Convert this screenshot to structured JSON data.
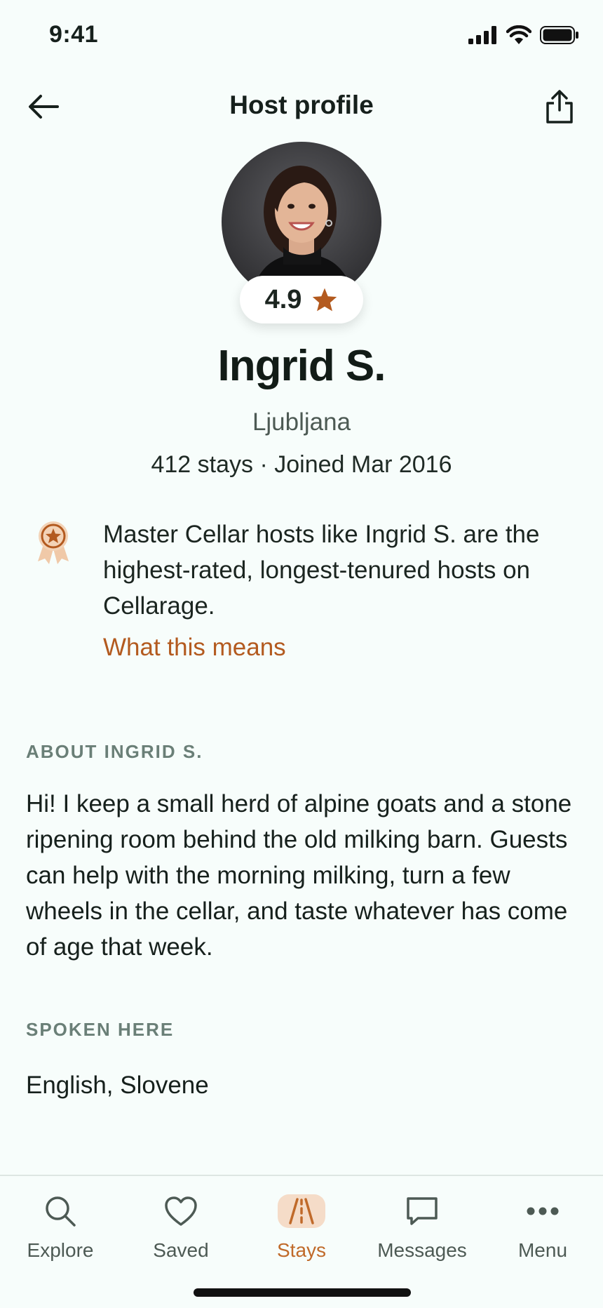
{
  "status_bar": {
    "time": "9:41"
  },
  "header": {
    "title": "Host profile"
  },
  "host": {
    "rating": "4.9",
    "name": "Ingrid S.",
    "city": "Ljubljana",
    "stats": "412 stays · Joined Mar 2016"
  },
  "badge": {
    "text": "Master Cellar hosts like Ingrid S. are the highest-rated, longest-tenured hosts on Cellarage.",
    "link": "What this means"
  },
  "about": {
    "label": "ABOUT INGRID S.",
    "text": "Hi! I keep a small herd of alpine goats and a stone ripening room behind the old milking barn. Guests can help with the morning milking, turn a few wheels in the cellar, and taste whatever has come of age that week."
  },
  "spoken": {
    "label": "SPOKEN HERE",
    "text": "English, Slovene"
  },
  "tabs": [
    {
      "label": "Explore",
      "icon": "search-icon",
      "active": false
    },
    {
      "label": "Saved",
      "icon": "heart-icon",
      "active": false
    },
    {
      "label": "Stays",
      "icon": "road-icon",
      "active": true
    },
    {
      "label": "Messages",
      "icon": "chat-icon",
      "active": false
    },
    {
      "label": "Menu",
      "icon": "more-icon",
      "active": false
    }
  ],
  "colors": {
    "accent": "#b35a1f",
    "background": "#f7fdfb",
    "section_label": "#6a7f77"
  }
}
